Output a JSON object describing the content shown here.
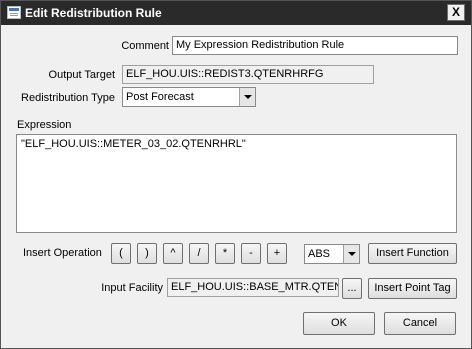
{
  "window": {
    "title": "Edit Redistribution Rule",
    "close_glyph": "X"
  },
  "comment": {
    "label": "Comment",
    "value": "My Expression Redistribution Rule"
  },
  "output_target": {
    "label": "Output Target",
    "value": "ELF_HOU.UIS::REDIST3.QTENRHRFG"
  },
  "redistribution_type": {
    "label": "Redistribution Type",
    "selected": "Post Forecast"
  },
  "expression": {
    "label": "Expression",
    "value": "\"ELF_HOU.UIS::METER_03_02.QTENRHRL\""
  },
  "insert_operation": {
    "label": "Insert Operation",
    "operators": [
      "(",
      ")",
      "^",
      "/",
      "*",
      "-",
      "+"
    ],
    "function_selected": "ABS",
    "insert_function_label": "Insert Function"
  },
  "input_facility": {
    "label": "Input Facility",
    "value": "ELF_HOU.UIS::BASE_MTR.QTENRI",
    "browse_label": "...",
    "insert_point_tag_label": "Insert Point Tag"
  },
  "buttons": {
    "ok": "OK",
    "cancel": "Cancel"
  }
}
